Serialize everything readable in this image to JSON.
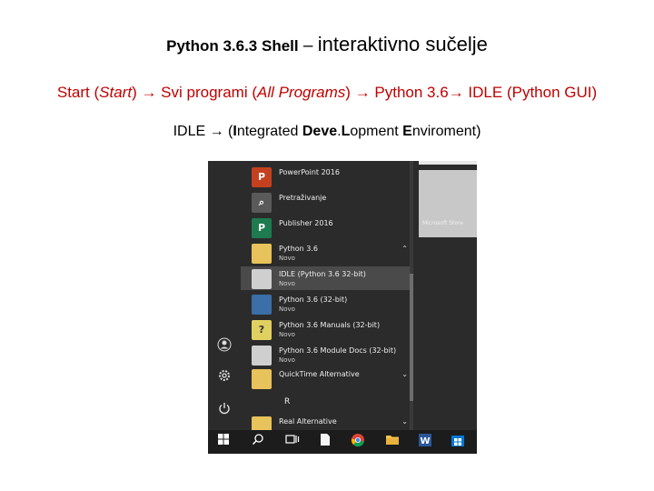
{
  "heading": {
    "bold": "Python 3.6.3 Shell",
    "dash": " – ",
    "light": "interaktivno sučelje"
  },
  "path": {
    "p1": "Start (",
    "p1i": "Start",
    "p2": ") ",
    "arrow": "→",
    "p3": " Svi programi (",
    "p3i": "All Programs",
    "p4": ") ",
    "p5": " Python 3.6",
    "p6": " IDLE (Python GUI)"
  },
  "idle": {
    "a": "IDLE ",
    "arrow": "→",
    "b": " (",
    "c1": "I",
    "c2": "ntegrated ",
    "c3": "Deve",
    "c4": ".",
    "c5": "L",
    "c6": "opment ",
    "c7": "E",
    "c8": "nviroment)"
  },
  "start_menu": {
    "apps": [
      {
        "name": "PowerPoint 2016",
        "sub": "",
        "icon": "powerpoint-icon",
        "glyph": "P",
        "color": "#c4401f"
      },
      {
        "name": "Pretraživanje",
        "sub": "",
        "icon": "search-icon",
        "glyph": "⌕",
        "color": "#5a5a5a"
      },
      {
        "name": "Publisher 2016",
        "sub": "",
        "icon": "publisher-icon",
        "glyph": "P",
        "color": "#1e7b4f"
      },
      {
        "name": "Python 3.6",
        "sub": "Novo",
        "icon": "folder-icon",
        "glyph": "",
        "color": "#e8c25a"
      },
      {
        "name": "IDLE (Python 3.6 32-bit)",
        "sub": "Novo",
        "icon": "idle-icon",
        "glyph": "",
        "color": "#cfcfcf"
      },
      {
        "name": "Python 3.6 (32-bit)",
        "sub": "Novo",
        "icon": "python-icon",
        "glyph": "",
        "color": "#3c6ea8"
      },
      {
        "name": "Python 3.6 Manuals (32-bit)",
        "sub": "Novo",
        "icon": "manuals-icon",
        "glyph": "?",
        "color": "#e0d060"
      },
      {
        "name": "Python 3.6 Module Docs (32-bit)",
        "sub": "Novo",
        "icon": "docs-icon",
        "glyph": "",
        "color": "#cfcfcf"
      },
      {
        "name": "QuickTime Alternative",
        "sub": "",
        "icon": "folder-icon",
        "glyph": "",
        "color": "#e8c25a"
      },
      {
        "name": "Real Alternative",
        "sub": "",
        "icon": "folder-icon",
        "glyph": "",
        "color": "#e8c25a"
      }
    ],
    "letter": "R",
    "chev_up": "⌃",
    "chev_down": "⌄",
    "tile_label": "Microsoft Store"
  }
}
